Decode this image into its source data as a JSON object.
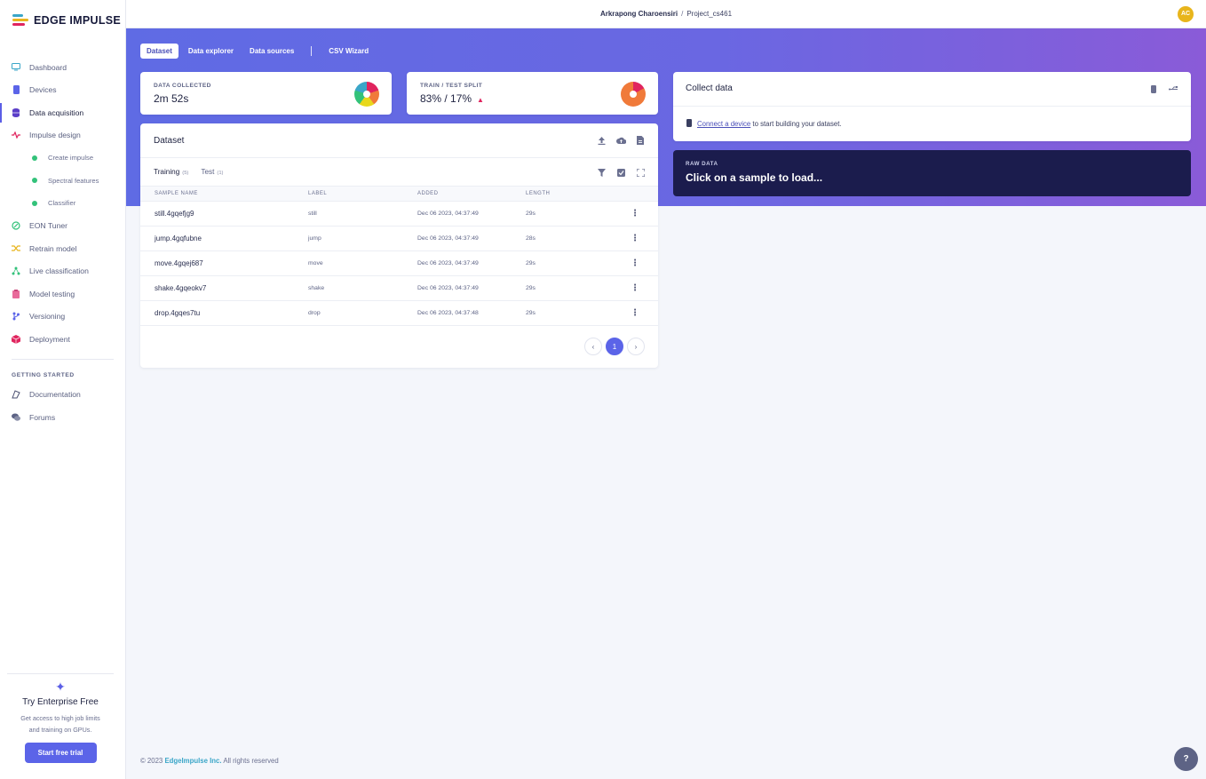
{
  "brand": {
    "name": "EDGE IMPULSE"
  },
  "topbar": {
    "user": "Arkrapong Charoensiri",
    "separator": "/",
    "project": "Project_cs461",
    "avatar_initials": "AC"
  },
  "sidebar": {
    "items": [
      {
        "label": "Dashboard",
        "icon": "monitor-icon",
        "color": "#3aa6c8"
      },
      {
        "label": "Devices",
        "icon": "device-icon",
        "color": "#5b64e8"
      },
      {
        "label": "Data acquisition",
        "icon": "database-icon",
        "color": "#5b3ec8",
        "active": true
      },
      {
        "label": "Impulse design",
        "icon": "pulse-icon",
        "color": "#e0245e"
      }
    ],
    "sub_items": [
      {
        "label": "Create impulse"
      },
      {
        "label": "Spectral features"
      },
      {
        "label": "Classifier"
      }
    ],
    "items2": [
      {
        "label": "EON Tuner",
        "icon": "tuner-icon",
        "color": "#33c27a"
      },
      {
        "label": "Retrain model",
        "icon": "shuffle-icon",
        "color": "#e8b51c"
      },
      {
        "label": "Live classification",
        "icon": "live-icon",
        "color": "#33c27a"
      },
      {
        "label": "Model testing",
        "icon": "clipboard-icon",
        "color": "#e86a9a"
      },
      {
        "label": "Versioning",
        "icon": "branch-icon",
        "color": "#5b64e8"
      },
      {
        "label": "Deployment",
        "icon": "box-icon",
        "color": "#e0245e"
      }
    ],
    "getting_started_heading": "GETTING STARTED",
    "getting_started": [
      {
        "label": "Documentation",
        "icon": "docs-icon"
      },
      {
        "label": "Forums",
        "icon": "forum-icon"
      }
    ],
    "trial": {
      "title": "Try Enterprise Free",
      "desc_line1": "Get access to high job limits",
      "desc_line2": "and training on GPUs.",
      "button": "Start free trial"
    }
  },
  "tabs": {
    "dataset": "Dataset",
    "explorer": "Data explorer",
    "sources": "Data sources",
    "csv": "CSV Wizard"
  },
  "stats": {
    "collected_label": "DATA COLLECTED",
    "collected_value": "2m 52s",
    "split_label": "TRAIN / TEST SPLIT",
    "split_value": "83% / 17%",
    "train_fraction": 0.83,
    "test_fraction": 0.17
  },
  "dataset": {
    "title": "Dataset",
    "training_label": "Training",
    "training_count": "(5)",
    "test_label": "Test",
    "test_count": "(1)",
    "columns": {
      "name": "SAMPLE NAME",
      "label": "LABEL",
      "added": "ADDED",
      "length": "LENGTH"
    },
    "rows": [
      {
        "name": "still.4gqefjg9",
        "label": "still",
        "added": "Dec 06 2023, 04:37:49",
        "length": "29s"
      },
      {
        "name": "jump.4gqfubne",
        "label": "jump",
        "added": "Dec 06 2023, 04:37:49",
        "length": "28s"
      },
      {
        "name": "move.4gqej687",
        "label": "move",
        "added": "Dec 06 2023, 04:37:49",
        "length": "29s"
      },
      {
        "name": "shake.4gqeokv7",
        "label": "shake",
        "added": "Dec 06 2023, 04:37:49",
        "length": "29s"
      },
      {
        "name": "drop.4gqes7tu",
        "label": "drop",
        "added": "Dec 06 2023, 04:37:48",
        "length": "29s"
      }
    ],
    "page": "1"
  },
  "collect": {
    "title": "Collect data",
    "link": "Connect a device",
    "text": "to start building your dataset."
  },
  "raw": {
    "label": "RAW DATA",
    "text": "Click on a sample to load..."
  },
  "footer": {
    "copyright": "© 2023",
    "company": "EdgeImpulse Inc.",
    "rights": "All rights reserved"
  },
  "colors": {
    "accent": "#5b64e8",
    "raw_bg": "#1b1c4d",
    "warning": "#e0245e"
  }
}
